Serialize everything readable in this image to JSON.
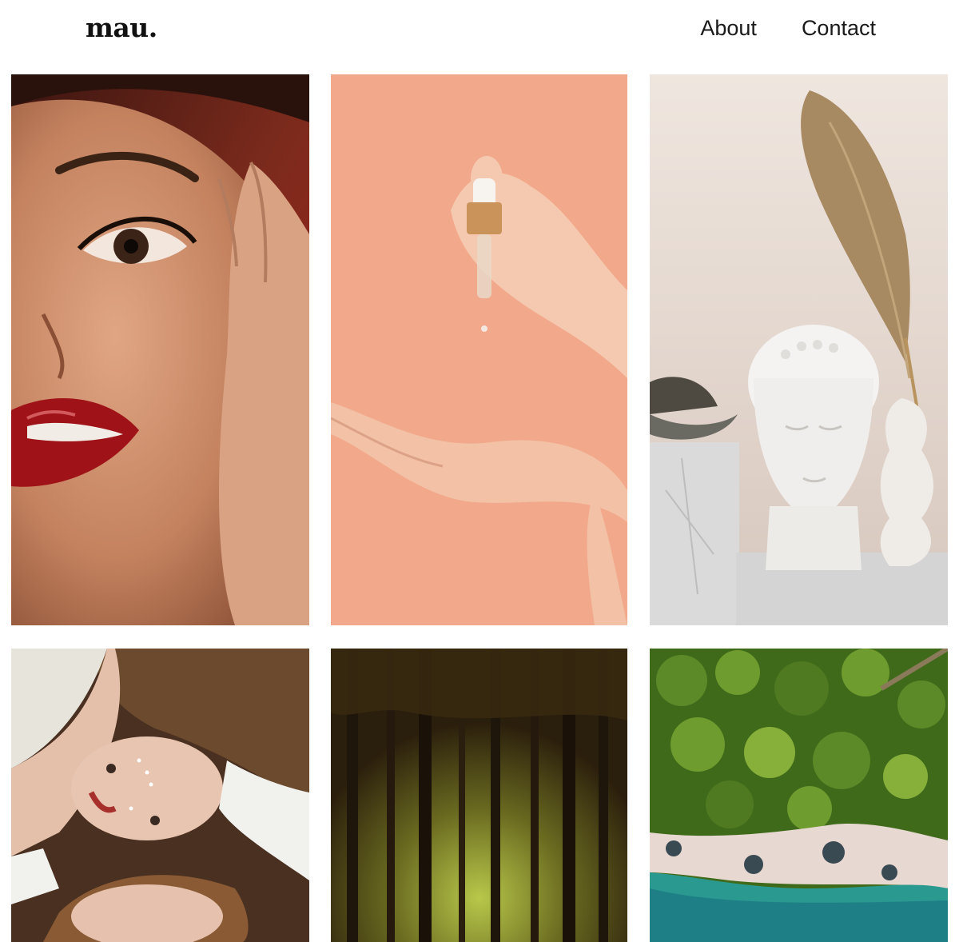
{
  "header": {
    "logo": "mau.",
    "nav": [
      {
        "label": "About"
      },
      {
        "label": "Contact"
      }
    ]
  },
  "gallery": {
    "tiles": [
      {
        "subject": "portrait-red-lips",
        "colors": {
          "bg": "#6b2a1e",
          "skin": "#c98a68",
          "lip": "#a3151a"
        }
      },
      {
        "subject": "hands-serum-dropper",
        "colors": {
          "bg": "#f2a88a",
          "skin": "#f3c6ae",
          "metal": "#c9935a"
        }
      },
      {
        "subject": "buddha-head-decor",
        "colors": {
          "bg": "#e8dcd4",
          "marble": "#dcdcdc",
          "plume": "#a88a62"
        }
      },
      {
        "subject": "two-women-lying",
        "colors": {
          "hair": "#6b4a2e",
          "skin": "#e6c2ae",
          "shirt": "#f1f1ee"
        }
      },
      {
        "subject": "forest-trees",
        "colors": {
          "dark": "#2e2410",
          "light": "#8aa83a",
          "trunk": "#1e160a"
        }
      },
      {
        "subject": "aerial-coast",
        "colors": {
          "trees": "#4f7a22",
          "sand": "#e8d8d2",
          "water": "#2a9a90"
        }
      }
    ]
  }
}
